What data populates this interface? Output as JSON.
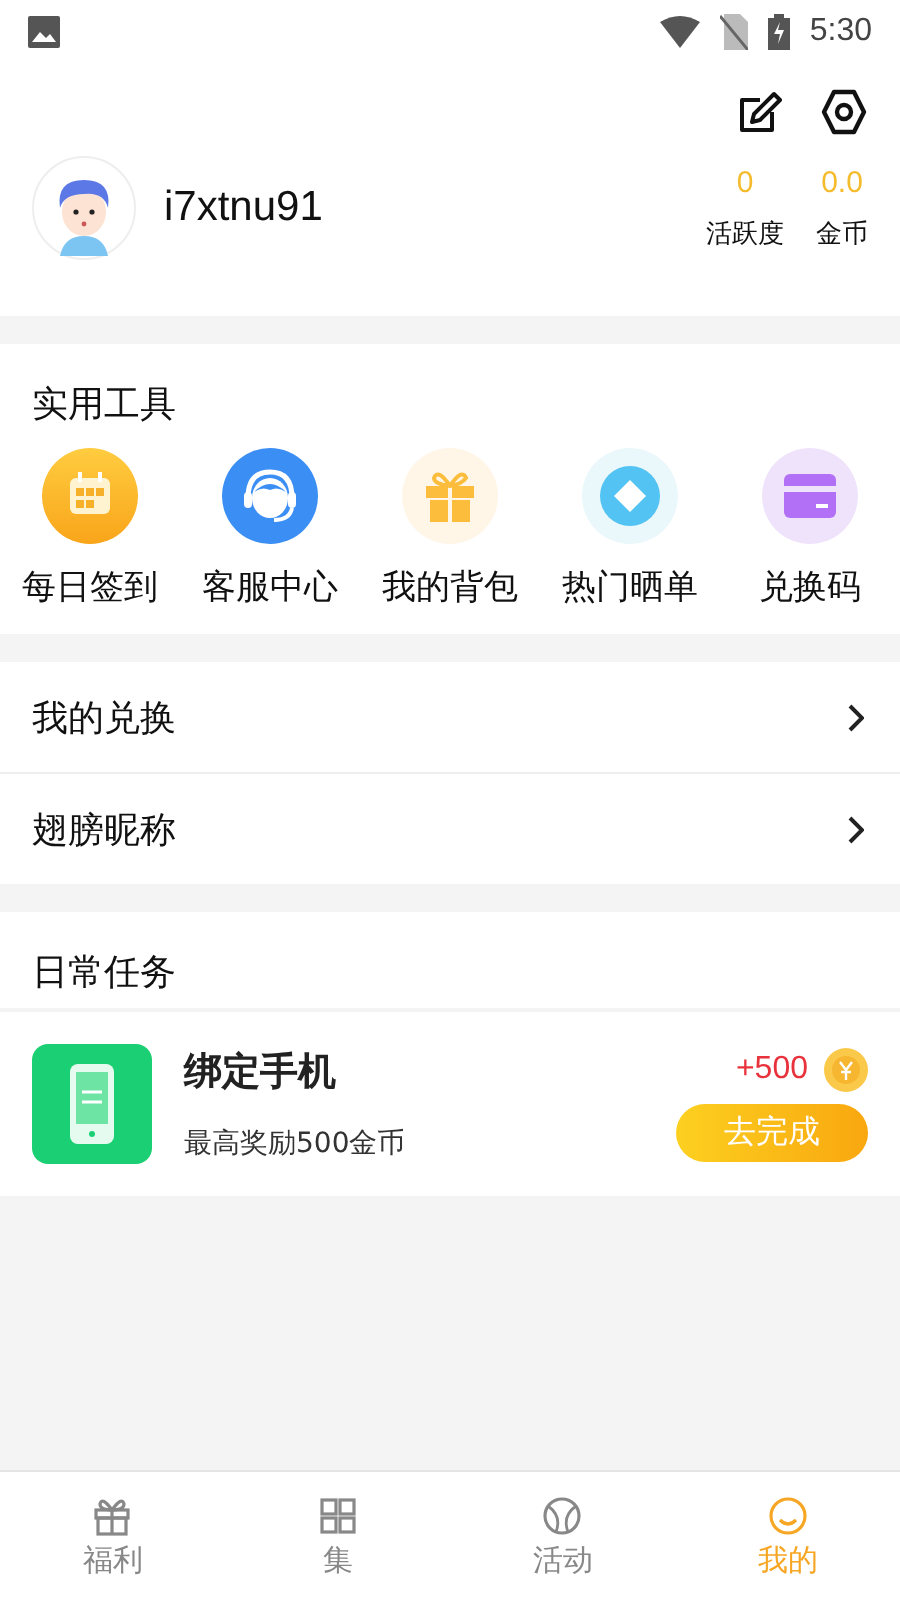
{
  "status_bar": {
    "time": "5:30"
  },
  "profile": {
    "username": "i7xtnu91",
    "stats": [
      {
        "value": "0",
        "label": "活跃度"
      },
      {
        "value": "0.0",
        "label": "金币"
      }
    ]
  },
  "tools": {
    "title": "实用工具",
    "items": [
      {
        "label": "每日签到",
        "kind": "calendar"
      },
      {
        "label": "客服中心",
        "kind": "support"
      },
      {
        "label": "我的背包",
        "kind": "gift"
      },
      {
        "label": "热门晒单",
        "kind": "diamond"
      },
      {
        "label": "兑换码",
        "kind": "card"
      }
    ]
  },
  "menu": [
    {
      "label": "我的兑换"
    },
    {
      "label": "翅膀昵称"
    }
  ],
  "tasks": {
    "title": "日常任务",
    "items": [
      {
        "title": "绑定手机",
        "description": "最高奖励500金币",
        "reward": "+500",
        "button": "去完成"
      }
    ]
  },
  "tab_bar": [
    {
      "label": "福利",
      "kind": "gift",
      "selected": false
    },
    {
      "label": "集",
      "kind": "grid",
      "selected": false
    },
    {
      "label": "活动",
      "kind": "ball",
      "selected": false
    },
    {
      "label": "我的",
      "kind": "face",
      "selected": true
    }
  ]
}
